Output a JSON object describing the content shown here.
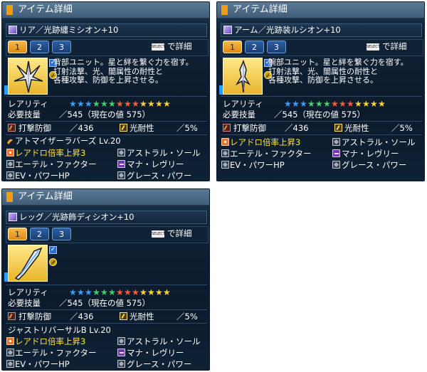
{
  "panels": [
    {
      "window_title": "アイテム詳細",
      "item_name": "リア／光跡纏ミシオン+10",
      "tabs": [
        "1",
        "2",
        "3"
      ],
      "select_button": "SELECT",
      "select_text": "で詳細",
      "description": [
        "背部ユニット。星と絆を繋ぐ力を宿す。",
        "打射法撃、光、闇属性の耐性と",
        "各種攻撃、防御を上昇させる。"
      ],
      "rarity_label": "レアリティ",
      "skill_label": "必要技量",
      "skill_value": "545（現在の値 575）",
      "stat1_label": "打撃防御",
      "stat1_value": "436",
      "stat2_label": "光耐性",
      "stat2_value": "5%",
      "ability_header": "アトマイザーラバーズ Lv.20",
      "abilities": [
        "レアドロ倍率上昇3",
        "アストラル・ソール",
        "エーテル・ファクター",
        "マナ・レヴリー",
        "EV・パワーHP",
        "グレース・パワー"
      ]
    },
    {
      "window_title": "アイテム詳細",
      "item_name": "アーム／光跡装ルシオン+10",
      "tabs": [
        "1",
        "2",
        "3"
      ],
      "select_button": "SELECT",
      "select_text": "で詳細",
      "description": [
        "腕部ユニット。星と絆を繋ぐ力を宿す。",
        "打射法撃、光、闇属性の耐性と",
        "各種攻撃、防御を上昇させる。"
      ],
      "rarity_label": "レアリティ",
      "skill_label": "必要技量",
      "skill_value": "545（現在の値 575）",
      "stat1_label": "打撃防御",
      "stat1_value": "436",
      "stat2_label": "光耐性",
      "stat2_value": "5%",
      "ability_header": "",
      "abilities": [
        "レアドロ倍率上昇3",
        "アストラル・ソール",
        "エーテル・ファクター",
        "マナ・レヴリー",
        "EV・パワーHP",
        "グレース・パワー"
      ]
    },
    {
      "window_title": "アイテム詳細",
      "item_name": "レッグ／光跡飾ディシオン+10",
      "tabs": [
        "1",
        "2",
        "3"
      ],
      "select_button": "SELECT",
      "select_text": "で詳細",
      "description": [
        "",
        "",
        ""
      ],
      "rarity_label": "レアリティ",
      "skill_label": "必要技量",
      "skill_value": "545（現在の値 575）",
      "stat1_label": "打撃防御",
      "stat1_value": "436",
      "stat2_label": "光耐性",
      "stat2_value": "5%",
      "ability_header": "ジャストリバーサルB Lv.20",
      "abilities": [
        "レアドロ倍率上昇3",
        "アストラル・ソール",
        "エーテル・ファクター",
        "マナ・レヴリー",
        "EV・パワーHP",
        "グレース・パワー"
      ]
    }
  ],
  "rarity_stars": 13,
  "star_colors": [
    "#3aa0ff",
    "#3aa0ff",
    "#3aa0ff",
    "#3fd46a",
    "#3fd46a",
    "#3fd46a",
    "#ff5a3a",
    "#ff5a3a",
    "#ff5a3a",
    "#ffd23a",
    "#ffd23a",
    "#ffd23a",
    "#ffd23a"
  ],
  "colors": {
    "accent": "#f39c12",
    "highlight_text": "#ffe43a",
    "tab_active": "#f0a020",
    "tab_inactive": "#2d5fa3"
  }
}
